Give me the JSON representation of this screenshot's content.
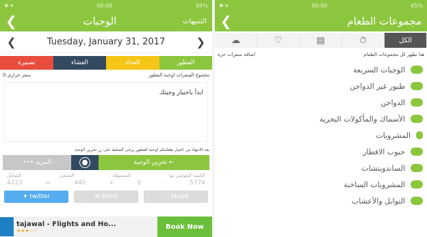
{
  "left": {
    "status": {
      "time": "00:00",
      "battery": "64%"
    },
    "appbar": {
      "title": "الوجبات",
      "back": "❮",
      "notifications": "التنبيهات"
    },
    "date": {
      "prev": "❮",
      "text": "Tuesday, January 31, 2017",
      "next": "❯"
    },
    "meal_tabs": [
      {
        "label": "الفطور",
        "color": "#8cc63f"
      },
      {
        "label": "الغداء",
        "color": "#f5c518"
      },
      {
        "label": "العشاء",
        "color": "#33495f"
      },
      {
        "label": "تصبيرة",
        "color": "#e74c3c"
      }
    ],
    "summary": {
      "label": "مجموع السعرات لوجبة الفطور",
      "value": "0 سعر حراري"
    },
    "content_text": "ابدأ باختيار وجبتك",
    "note": "بعد الانتهاء من اختيار طعامكم لوجبة الفطور يرجى الضغط على زر تخزين الوجبة",
    "actions": {
      "save": "تخزين الوجبة",
      "more": "المزيد"
    },
    "stats": {
      "headers": [
        "الكمية الموصى بها",
        "المستهلك",
        "المتبقي",
        "الشامل"
      ],
      "values": [
        "5774",
        "-",
        "0",
        "+",
        "440",
        "=",
        "4223"
      ]
    },
    "share": {
      "twitter": "twitter",
      "send": "Send",
      "share": "Share"
    },
    "ad": {
      "title": "tajawal - Flights and Ho...",
      "stars": "★★★☆☆",
      "button": "Book Now"
    }
  },
  "right": {
    "status": {
      "time": "00:00",
      "battery": "65%"
    },
    "appbar": {
      "title": "مجموعات الطعام",
      "back": "❮"
    },
    "filter_tabs": [
      {
        "label": "الكل",
        "active": true
      },
      {
        "label": "⏱",
        "icon": "clock-icon"
      },
      {
        "label": "▤",
        "icon": "list-icon"
      },
      {
        "label": "♡",
        "icon": "heart-icon"
      },
      {
        "label": "☁",
        "icon": "hat-icon"
      }
    ],
    "header": {
      "info": "هنا تظهر كل مجموعات الطعام",
      "add": "اضافة سعرات حرة"
    },
    "categories": [
      "الوجبات السريعة",
      "طيور غير الدواجن",
      "الدواجن",
      "الأسماك والمأكولات البحرية",
      "المشروبات",
      "حبوب الافطار",
      "الساندويتشات",
      "المشروبات الساخنة",
      "التوابل والأعشاب"
    ]
  }
}
